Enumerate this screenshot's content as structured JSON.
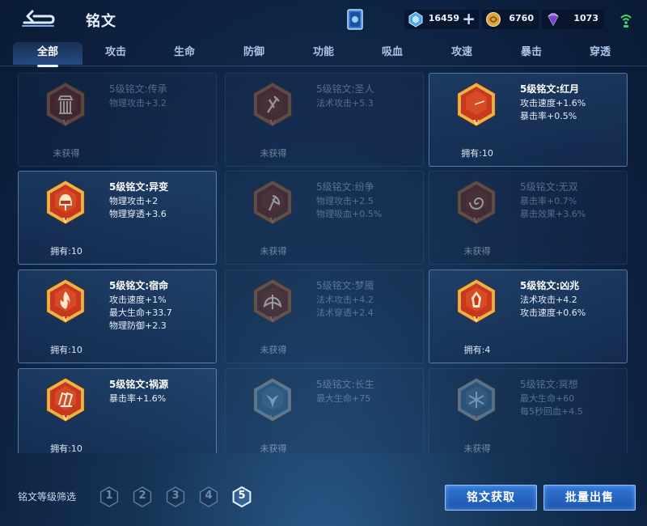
{
  "header": {
    "title": "铭文",
    "currencies": {
      "coupon": "16459",
      "gold": "6760",
      "gems": "1073"
    }
  },
  "tabs": [
    {
      "label": "全部",
      "active": true
    },
    {
      "label": "攻击"
    },
    {
      "label": "生命"
    },
    {
      "label": "防御"
    },
    {
      "label": "功能"
    },
    {
      "label": "吸血"
    },
    {
      "label": "攻速"
    },
    {
      "label": "暴击"
    },
    {
      "label": "穿透"
    }
  ],
  "runes": [
    {
      "name": "5级铭文:传承",
      "attrs": [
        "物理攻击+3.2"
      ],
      "status": "未获得",
      "owned": false,
      "icon": "pillar-icon"
    },
    {
      "name": "5级铭文:圣人",
      "attrs": [
        "法术攻击+5.3"
      ],
      "status": "未获得",
      "owned": false,
      "icon": "staff-icon"
    },
    {
      "name": "5级铭文:红月",
      "attrs": [
        "攻击速度+1.6%",
        "暴击率+0.5%"
      ],
      "status": "拥有:10",
      "owned": true,
      "icon": "moon-icon"
    },
    {
      "name": "5级铭文:异变",
      "attrs": [
        "物理攻击+2",
        "物理穿透+3.6"
      ],
      "status": "拥有:10",
      "owned": true,
      "icon": "helmet-icon"
    },
    {
      "name": "5级铭文:纷争",
      "attrs": [
        "物理攻击+2.5",
        "物理吸血+0.5%"
      ],
      "status": "未获得",
      "owned": false,
      "icon": "axe-icon"
    },
    {
      "name": "5级铭文:无双",
      "attrs": [
        "暴击率+0.7%",
        "暴击效果+3.6%"
      ],
      "status": "未获得",
      "owned": false,
      "icon": "swirl-icon"
    },
    {
      "name": "5级铭文:宿命",
      "attrs": [
        "攻击速度+1%",
        "最大生命+33.7",
        "物理防御+2.3"
      ],
      "status": "拥有:10",
      "owned": true,
      "icon": "flame-icon"
    },
    {
      "name": "5级铭文:梦魇",
      "attrs": [
        "法术攻击+4.2",
        "法术穿透+2.4"
      ],
      "status": "未获得",
      "owned": false,
      "icon": "wing-icon"
    },
    {
      "name": "5级铭文:凶兆",
      "attrs": [
        "法术攻击+4.2",
        "攻击速度+0.6%"
      ],
      "status": "拥有:4",
      "owned": true,
      "icon": "crystal-icon"
    },
    {
      "name": "5级铭文:祸源",
      "attrs": [
        "暴击率+1.6%"
      ],
      "status": "拥有:10",
      "owned": true,
      "icon": "cards-icon"
    },
    {
      "name": "5级铭文:长生",
      "attrs": [
        "最大生命+75"
      ],
      "status": "未获得",
      "owned": false,
      "icon": "tail-icon"
    },
    {
      "name": "5级铭文:冥想",
      "attrs": [
        "最大生命+60",
        "每5秒回血+4.5"
      ],
      "status": "未获得",
      "owned": false,
      "icon": "snowflake-icon"
    }
  ],
  "footer": {
    "filter_label": "铭文等级筛选",
    "levels": [
      "1",
      "2",
      "3",
      "4",
      "5"
    ],
    "selected_level": "5",
    "get_button": "铭文获取",
    "sell_button": "批量出售"
  }
}
